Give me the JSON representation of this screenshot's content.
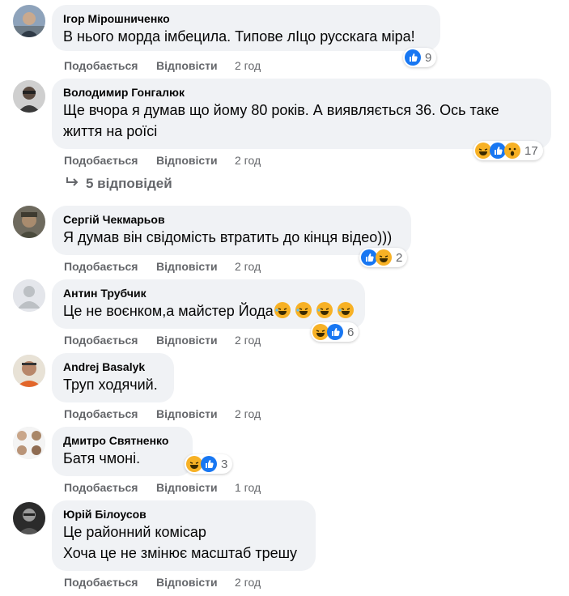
{
  "comments": [
    {
      "author": "Ігор Мірошниченко",
      "text": "В нього морда імбецила. Типове лІцо русскага міра!",
      "like_label": "Подобається",
      "reply_label": "Відповісти",
      "time": "2 год",
      "reactions": [
        "like"
      ],
      "reaction_count": "9",
      "avatar": "photo"
    },
    {
      "author": "Володимир Гонгалюк",
      "text": "Ще вчора я думав що йому 80 років. А виявляється 36. Ось таке\nжиття на роїсі",
      "like_label": "Подобається",
      "reply_label": "Відповісти",
      "time": "2 год",
      "reactions": [
        "haha",
        "like",
        "wow"
      ],
      "reaction_count": "17",
      "avatar": "photo",
      "replies_label": "5 відповідей"
    },
    {
      "author": "Сергій Чекмарьов",
      "text": "Я думав він свідомість втратить до кінця відео)))",
      "like_label": "Подобається",
      "reply_label": "Відповісти",
      "time": "2 год",
      "reactions": [
        "like",
        "haha"
      ],
      "reaction_count": "2",
      "avatar": "photo"
    },
    {
      "author": "Антин Трубчик",
      "text": "Це не воєнком,а майстер Йода",
      "inline_emoji": [
        "rofl",
        "rofl",
        "rofl",
        "rofl"
      ],
      "like_label": "Подобається",
      "reply_label": "Відповісти",
      "time": "2 год",
      "reactions": [
        "haha",
        "like"
      ],
      "reaction_count": "6",
      "avatar": "placeholder"
    },
    {
      "author": "Andrej Basalyk",
      "text": "Труп ходячий.",
      "like_label": "Подобається",
      "reply_label": "Відповісти",
      "time": "2 год",
      "avatar": "photo"
    },
    {
      "author": "Дмитро Святненко",
      "text": "Батя чмоні.",
      "like_label": "Подобається",
      "reply_label": "Відповісти",
      "time": "1 год",
      "reactions": [
        "haha",
        "like"
      ],
      "reaction_count": "3",
      "avatar": "photo"
    },
    {
      "author": "Юрій Білоусов",
      "text": "Це районний комісар\nХоча це не змінює масштаб трешу",
      "like_label": "Подобається",
      "reply_label": "Відповісти",
      "time": "2 год",
      "avatar": "photo"
    }
  ],
  "colors": {
    "bubble": "#f0f2f5",
    "secondary_text": "#65676b",
    "like_blue": "#1877f2",
    "haha_yellow": "#f7b125"
  }
}
